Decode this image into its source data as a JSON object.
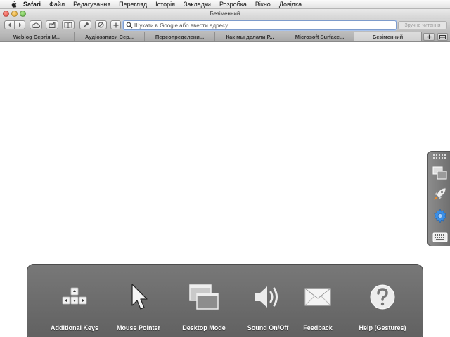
{
  "menubar": {
    "items": [
      "Safari",
      "Файл",
      "Редагування",
      "Перегляд",
      "Історія",
      "Закладки",
      "Розробка",
      "Вікно",
      "Довідка"
    ]
  },
  "window": {
    "title": "Безіменний"
  },
  "toolbar": {
    "url_placeholder": "Шукати в Google або ввести адресу",
    "reader_label": "Зручне читання"
  },
  "tabs": [
    {
      "label": "Weblog Сергія М..."
    },
    {
      "label": "Аудіозаписи Сер..."
    },
    {
      "label": "Переопределени..."
    },
    {
      "label": "Как мы делали Р..."
    },
    {
      "label": "Microsoft Surface..."
    },
    {
      "label": "Безіменний"
    }
  ],
  "side_panel": {
    "items": [
      "grip-icon",
      "windows-icon",
      "rocket-icon",
      "gear-icon",
      "keyboard-icon"
    ]
  },
  "bottom_panel": {
    "items": [
      {
        "label": "Additional Keys",
        "icon": "arrow-keys-icon"
      },
      {
        "label": "Mouse Pointer",
        "icon": "pointer-icon"
      },
      {
        "label": "Desktop Mode",
        "icon": "desktop-mode-icon"
      },
      {
        "label": "Sound On/Off",
        "icon": "speaker-icon"
      },
      {
        "label": "Feedback",
        "icon": "envelope-icon"
      },
      {
        "label": "Help (Gestures)",
        "icon": "help-icon"
      }
    ]
  }
}
